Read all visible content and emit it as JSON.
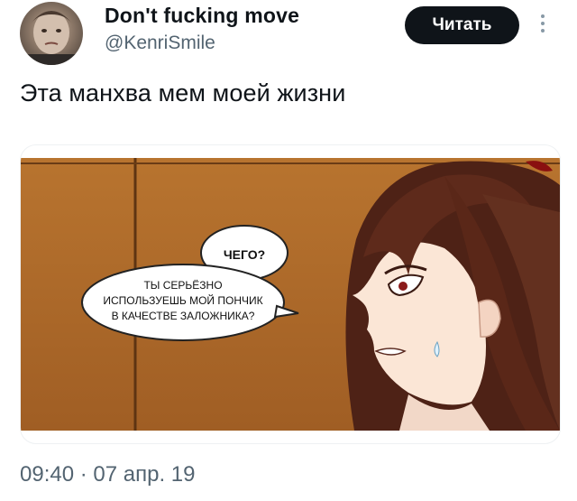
{
  "tweet": {
    "display_name": "Don't fucking move",
    "handle": "@KenriSmile",
    "follow_button": "Читать",
    "text": "Эта манхва мем моей жизни",
    "timestamp": "09:40 · 07 апр. 19"
  },
  "comic": {
    "bubble_small": "ЧЕГО?",
    "bubble_large_lines": [
      "ТЫ СЕРЬЁЗНО",
      "ИСПОЛЬЗУЕШЬ МОЙ ПОНЧИК",
      "В КАЧЕСТВЕ ЗАЛОЖНИКА?"
    ]
  },
  "colors": {
    "follow_bg": "#0f1419",
    "muted_text": "#536471",
    "wall_brown": "#b06a2c",
    "hair_brown": "#5a2a1a"
  },
  "icons": [
    "avatar-photo",
    "more-vertical-icon"
  ]
}
